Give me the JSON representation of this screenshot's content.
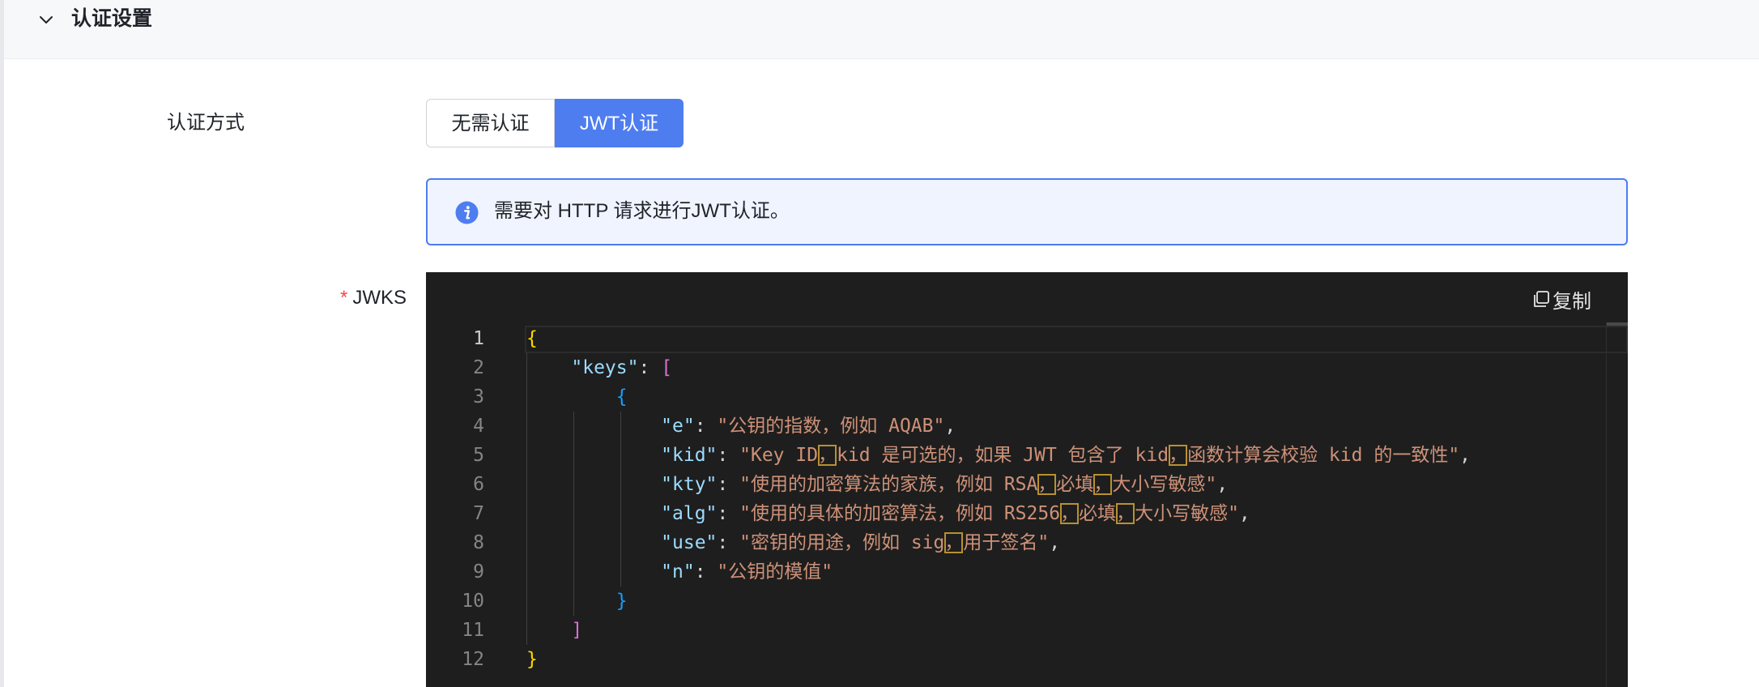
{
  "section": {
    "title": "认证设置"
  },
  "auth_method": {
    "label": "认证方式",
    "options": [
      "无需认证",
      "JWT认证"
    ],
    "selected": "JWT认证"
  },
  "alert": {
    "text": "需要对 HTTP 请求进行JWT认证。"
  },
  "jwks": {
    "required_mark": "*",
    "label": "JWKS",
    "copy_label": "复制",
    "code_lines": [
      {
        "n": "1",
        "segs": [
          [
            "b-yellow",
            "{"
          ]
        ]
      },
      {
        "n": "2",
        "segs": [
          [
            "punc",
            "    "
          ],
          [
            "key",
            "\"keys\""
          ],
          [
            "punc",
            ": "
          ],
          [
            "b-pink",
            "["
          ]
        ]
      },
      {
        "n": "3",
        "segs": [
          [
            "punc",
            "        "
          ],
          [
            "b-blue",
            "{"
          ]
        ]
      },
      {
        "n": "4",
        "segs": [
          [
            "punc",
            "            "
          ],
          [
            "key",
            "\"e\""
          ],
          [
            "punc",
            ": "
          ],
          [
            "str",
            "\"公钥的指数，例如 AQAB\""
          ],
          [
            "punc",
            ","
          ]
        ]
      },
      {
        "n": "5",
        "segs": [
          [
            "punc",
            "            "
          ],
          [
            "key",
            "\"kid\""
          ],
          [
            "punc",
            ": "
          ],
          [
            "str",
            "\"Key ID"
          ],
          [
            "str amb",
            "，"
          ],
          [
            "str",
            "kid 是可选的，如果 JWT 包含了 kid"
          ],
          [
            "str amb",
            "，"
          ],
          [
            "str",
            "函数计算会校验 kid 的一致性\""
          ],
          [
            "punc",
            ","
          ]
        ]
      },
      {
        "n": "6",
        "segs": [
          [
            "punc",
            "            "
          ],
          [
            "key",
            "\"kty\""
          ],
          [
            "punc",
            ": "
          ],
          [
            "str",
            "\"使用的加密算法的家族，例如 RSA"
          ],
          [
            "str amb",
            "，"
          ],
          [
            "str",
            "必填"
          ],
          [
            "str amb",
            "，"
          ],
          [
            "str",
            "大小写敏感\""
          ],
          [
            "punc",
            ","
          ]
        ]
      },
      {
        "n": "7",
        "segs": [
          [
            "punc",
            "            "
          ],
          [
            "key",
            "\"alg\""
          ],
          [
            "punc",
            ": "
          ],
          [
            "str",
            "\"使用的具体的加密算法，例如 RS256"
          ],
          [
            "str amb",
            "，"
          ],
          [
            "str",
            "必填"
          ],
          [
            "str amb",
            "，"
          ],
          [
            "str",
            "大小写敏感\""
          ],
          [
            "punc",
            ","
          ]
        ]
      },
      {
        "n": "8",
        "segs": [
          [
            "punc",
            "            "
          ],
          [
            "key",
            "\"use\""
          ],
          [
            "punc",
            ": "
          ],
          [
            "str",
            "\"密钥的用途，例如 sig"
          ],
          [
            "str amb",
            "，"
          ],
          [
            "str",
            "用于签名\""
          ],
          [
            "punc",
            ","
          ]
        ]
      },
      {
        "n": "9",
        "segs": [
          [
            "punc",
            "            "
          ],
          [
            "key",
            "\"n\""
          ],
          [
            "punc",
            ": "
          ],
          [
            "str",
            "\"公钥的模值\""
          ]
        ]
      },
      {
        "n": "10",
        "segs": [
          [
            "punc",
            "        "
          ],
          [
            "b-blue",
            "}"
          ]
        ]
      },
      {
        "n": "11",
        "segs": [
          [
            "punc",
            "    "
          ],
          [
            "b-pink",
            "]"
          ]
        ]
      },
      {
        "n": "12",
        "segs": [
          [
            "b-yellow",
            "}"
          ]
        ]
      }
    ]
  },
  "colors": {
    "accent": "#4e7df0",
    "alert_bg": "#f0f4ff",
    "editor_bg": "#1e1e1e",
    "required": "#f54a45"
  },
  "icons": {
    "collapse": "chevron-down-icon",
    "info": "info-icon",
    "copy": "copy-icon"
  }
}
